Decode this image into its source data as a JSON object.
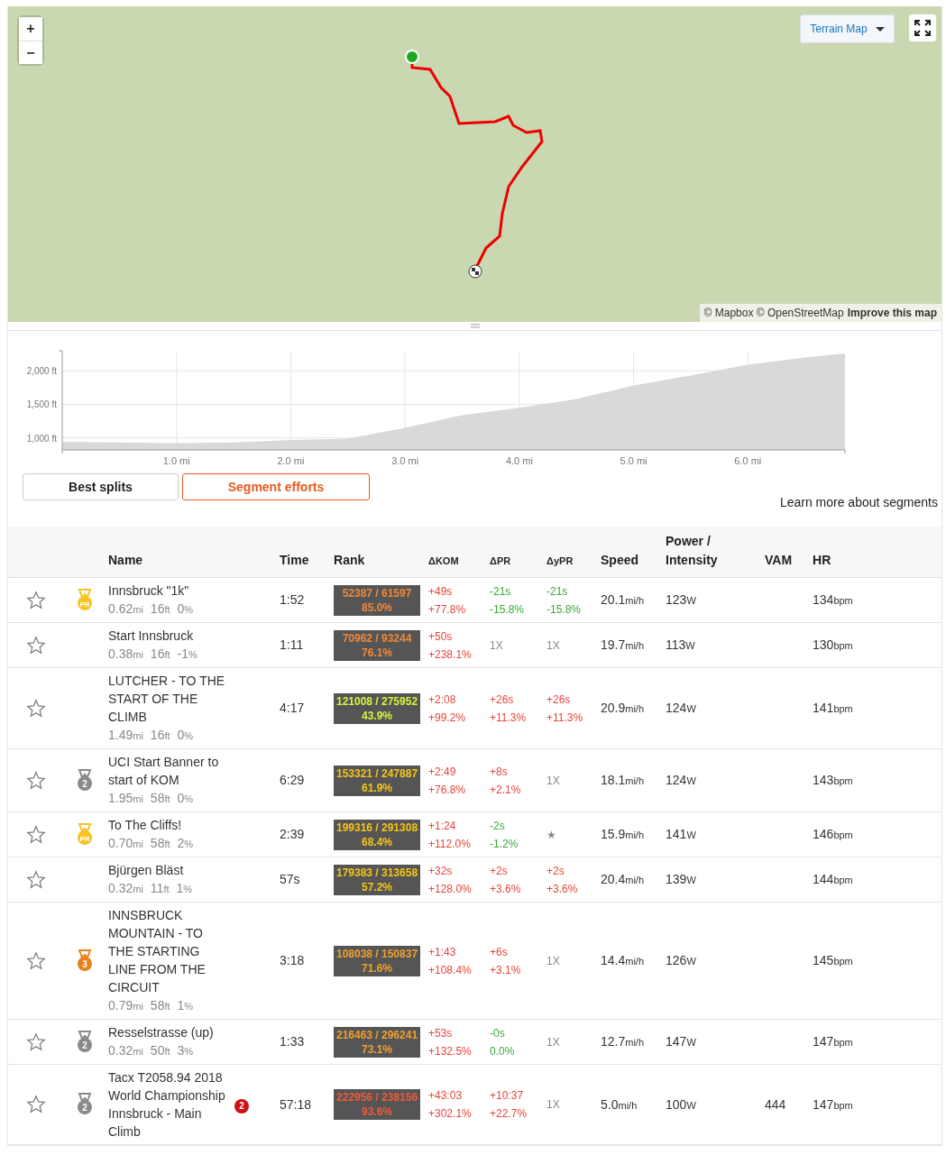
{
  "map": {
    "zoom_in": "+",
    "zoom_out": "−",
    "map_type": "Terrain Map",
    "attribution": "© Mapbox © OpenStreetMap",
    "improve_link": "Improve this map"
  },
  "elevation": {
    "chart_data": {
      "type": "area",
      "grid": true,
      "x": [
        0,
        0.5,
        1.0,
        1.5,
        2.0,
        2.5,
        3.0,
        3.5,
        4.0,
        4.5,
        5.0,
        5.5,
        6.0,
        6.5,
        6.85
      ],
      "series": [
        {
          "color": "#d9d9d9",
          "values": [
            940,
            930,
            920,
            930,
            970,
            990,
            1150,
            1340,
            1450,
            1580,
            1780,
            1930,
            2090,
            2200,
            2260
          ]
        }
      ],
      "xlim": [
        0,
        6.85
      ],
      "ylim": [
        820,
        2300
      ],
      "xticks": [
        {
          "value": 1,
          "label": "1.0 mi"
        },
        {
          "value": 2,
          "label": "2.0 mi"
        },
        {
          "value": 3,
          "label": "3.0 mi"
        },
        {
          "value": 4,
          "label": "4.0 mi"
        },
        {
          "value": 5,
          "label": "5.0 mi"
        },
        {
          "value": 6,
          "label": "6.0 mi"
        }
      ],
      "yticks": [
        {
          "value": 1000,
          "label": "1,000 ft"
        },
        {
          "value": 1500,
          "label": "1,500 ft"
        },
        {
          "value": 2000,
          "label": "2,000 ft"
        }
      ]
    }
  },
  "tabs": [
    {
      "label": "Best splits",
      "selected": false
    },
    {
      "label": "Segment efforts",
      "selected": true
    }
  ],
  "learn_more": "Learn more about segments",
  "table": {
    "columns": [
      "Name",
      "Time",
      "Rank",
      "ΔKOM",
      "ΔPR",
      "ΔyPR",
      "Speed",
      "Power / Intensity",
      "VAM",
      "HR"
    ],
    "rows": [
      {
        "starred": false,
        "medal": {
          "kind": "pr",
          "label": "PR"
        },
        "name": "Innsbruck \"1k\"",
        "distance": "0.62",
        "distance_unit": "mi",
        "elevation": "16",
        "elevation_unit": "ft",
        "grade": "0",
        "grade_unit": "%",
        "time": "1:52",
        "rank": {
          "text": "52387 / 61597",
          "pct": "85.0%",
          "color": "#f0883a"
        },
        "kom": {
          "color": "#e8443a",
          "time": "+49s",
          "pct": "+77.8%"
        },
        "pr": {
          "color": "#3aa83a",
          "time": "-21s",
          "pct": "-15.8%"
        },
        "ypr": {
          "color": "#3aa83a",
          "time": "-21s",
          "pct": "-15.8%"
        },
        "speed": "20.1",
        "speed_unit": "mi/h",
        "power": "123",
        "power_unit": "W",
        "hr": "134",
        "hr_unit": "bpm"
      },
      {
        "starred": false,
        "name": "Start Innsbruck",
        "distance": "0.38",
        "distance_unit": "mi",
        "elevation": "16",
        "elevation_unit": "ft",
        "grade": "-1",
        "grade_unit": "%",
        "time": "1:11",
        "rank": {
          "text": "70962 / 93244",
          "pct": "76.1%",
          "color": "#f0883a"
        },
        "kom": {
          "color": "#e8443a",
          "time": "+50s",
          "pct": "+238.1%"
        },
        "pr": {
          "color": "#888888",
          "time": "1X"
        },
        "ypr": {
          "color": "#888888",
          "time": "1X"
        },
        "speed": "19.7",
        "speed_unit": "mi/h",
        "power": "113",
        "power_unit": "W",
        "hr": "130",
        "hr_unit": "bpm"
      },
      {
        "starred": false,
        "name": "LUTCHER - TO THE START OF THE CLIMB",
        "distance": "1.49",
        "distance_unit": "mi",
        "elevation": "16",
        "elevation_unit": "ft",
        "grade": "0",
        "grade_unit": "%",
        "time": "4:17",
        "rank": {
          "text": "121008 / 275952",
          "pct": "43.9%",
          "color": "#d4f53c"
        },
        "kom": {
          "color": "#e8443a",
          "time": "+2:08",
          "pct": "+99.2%"
        },
        "pr": {
          "color": "#e8443a",
          "time": "+26s",
          "pct": "+11.3%"
        },
        "ypr": {
          "color": "#e8443a",
          "time": "+26s",
          "pct": "+11.3%"
        },
        "speed": "20.9",
        "speed_unit": "mi/h",
        "power": "124",
        "power_unit": "W",
        "hr": "141",
        "hr_unit": "bpm"
      },
      {
        "starred": false,
        "medal": {
          "kind": "silver",
          "label": "2"
        },
        "name": "UCI Start Banner to start of KOM",
        "distance": "1.95",
        "distance_unit": "mi",
        "elevation": "58",
        "elevation_unit": "ft",
        "grade": "0",
        "grade_unit": "%",
        "time": "6:29",
        "rank": {
          "text": "153321 / 247887",
          "pct": "61.9%",
          "color": "#f5c518"
        },
        "kom": {
          "color": "#e8443a",
          "time": "+2:49",
          "pct": "+76.8%"
        },
        "pr": {
          "color": "#e8443a",
          "time": "+8s",
          "pct": "+2.1%"
        },
        "ypr": {
          "color": "#888888",
          "time": "1X"
        },
        "speed": "18.1",
        "speed_unit": "mi/h",
        "power": "124",
        "power_unit": "W",
        "hr": "143",
        "hr_unit": "bpm"
      },
      {
        "starred": false,
        "medal": {
          "kind": "pr",
          "label": "PR"
        },
        "name": "To The Cliffs!",
        "distance": "0.70",
        "distance_unit": "mi",
        "elevation": "58",
        "elevation_unit": "ft",
        "grade": "2",
        "grade_unit": "%",
        "time": "2:39",
        "rank": {
          "text": "199316 / 291308",
          "pct": "68.4%",
          "color": "#f5c518"
        },
        "kom": {
          "color": "#e8443a",
          "time": "+1:24",
          "pct": "+112.0%"
        },
        "pr": {
          "color": "#3aa83a",
          "time": "-2s",
          "pct": "-1.2%"
        },
        "ypr": {
          "color": "#888888",
          "time": "★"
        },
        "speed": "15.9",
        "speed_unit": "mi/h",
        "power": "141",
        "power_unit": "W",
        "hr": "146",
        "hr_unit": "bpm"
      },
      {
        "starred": false,
        "name": "Bjürgen Bläst",
        "distance": "0.32",
        "distance_unit": "mi",
        "elevation": "11",
        "elevation_unit": "ft",
        "grade": "1",
        "grade_unit": "%",
        "time": "57s",
        "rank": {
          "text": "179383 / 313658",
          "pct": "57.2%",
          "color": "#f5c518"
        },
        "kom": {
          "color": "#e8443a",
          "time": "+32s",
          "pct": "+128.0%"
        },
        "pr": {
          "color": "#e8443a",
          "time": "+2s",
          "pct": "+3.6%"
        },
        "ypr": {
          "color": "#e8443a",
          "time": "+2s",
          "pct": "+3.6%"
        },
        "speed": "20.4",
        "speed_unit": "mi/h",
        "power": "139",
        "power_unit": "W",
        "hr": "144",
        "hr_unit": "bpm"
      },
      {
        "starred": false,
        "medal": {
          "kind": "bronze",
          "label": "3"
        },
        "name": "INNSBRUCK MOUNTAIN - TO THE STARTING LINE FROM THE CIRCUIT",
        "distance": "0.79",
        "distance_unit": "mi",
        "elevation": "58",
        "elevation_unit": "ft",
        "grade": "1",
        "grade_unit": "%",
        "time": "3:18",
        "rank": {
          "text": "108038 / 150837",
          "pct": "71.6%",
          "color": "#f0a030"
        },
        "kom": {
          "color": "#e8443a",
          "time": "+1:43",
          "pct": "+108.4%"
        },
        "pr": {
          "color": "#e8443a",
          "time": "+6s",
          "pct": "+3.1%"
        },
        "ypr": {
          "color": "#888888",
          "time": "1X"
        },
        "speed": "14.4",
        "speed_unit": "mi/h",
        "power": "126",
        "power_unit": "W",
        "hr": "145",
        "hr_unit": "bpm"
      },
      {
        "starred": false,
        "medal": {
          "kind": "silver",
          "label": "2"
        },
        "name": "Resselstrasse (up)",
        "distance": "0.32",
        "distance_unit": "mi",
        "elevation": "50",
        "elevation_unit": "ft",
        "grade": "3",
        "grade_unit": "%",
        "time": "1:33",
        "rank": {
          "text": "216463 / 296241",
          "pct": "73.1%",
          "color": "#f0a030"
        },
        "kom": {
          "color": "#e8443a",
          "time": "+53s",
          "pct": "+132.5%"
        },
        "pr": {
          "color": "#3aa83a",
          "time": "-0s",
          "pct": "0.0%"
        },
        "ypr": {
          "color": "#888888",
          "time": "1X"
        },
        "speed": "12.7",
        "speed_unit": "mi/h",
        "power": "147",
        "power_unit": "W",
        "hr": "147",
        "hr_unit": "bpm"
      },
      {
        "starred": false,
        "medal": {
          "kind": "silver",
          "label": "2"
        },
        "name": "Tacx T2058.94 2018 World Championship Innsbruck - Main Climb",
        "alert": "2",
        "time": "57:18",
        "rank": {
          "text": "222956 / 238156",
          "pct": "93.6%",
          "color": "#f05a3a"
        },
        "kom": {
          "color": "#e8443a",
          "time": "+43:03",
          "pct": "+302.1%"
        },
        "pr": {
          "color": "#e8443a",
          "time": "+10:37",
          "pct": "+22.7%"
        },
        "ypr": {
          "color": "#888888",
          "time": "1X"
        },
        "speed": "5.0",
        "speed_unit": "mi/h",
        "power": "100",
        "power_unit": "W",
        "vam": "444",
        "hr": "147",
        "hr_unit": "bpm"
      }
    ]
  }
}
